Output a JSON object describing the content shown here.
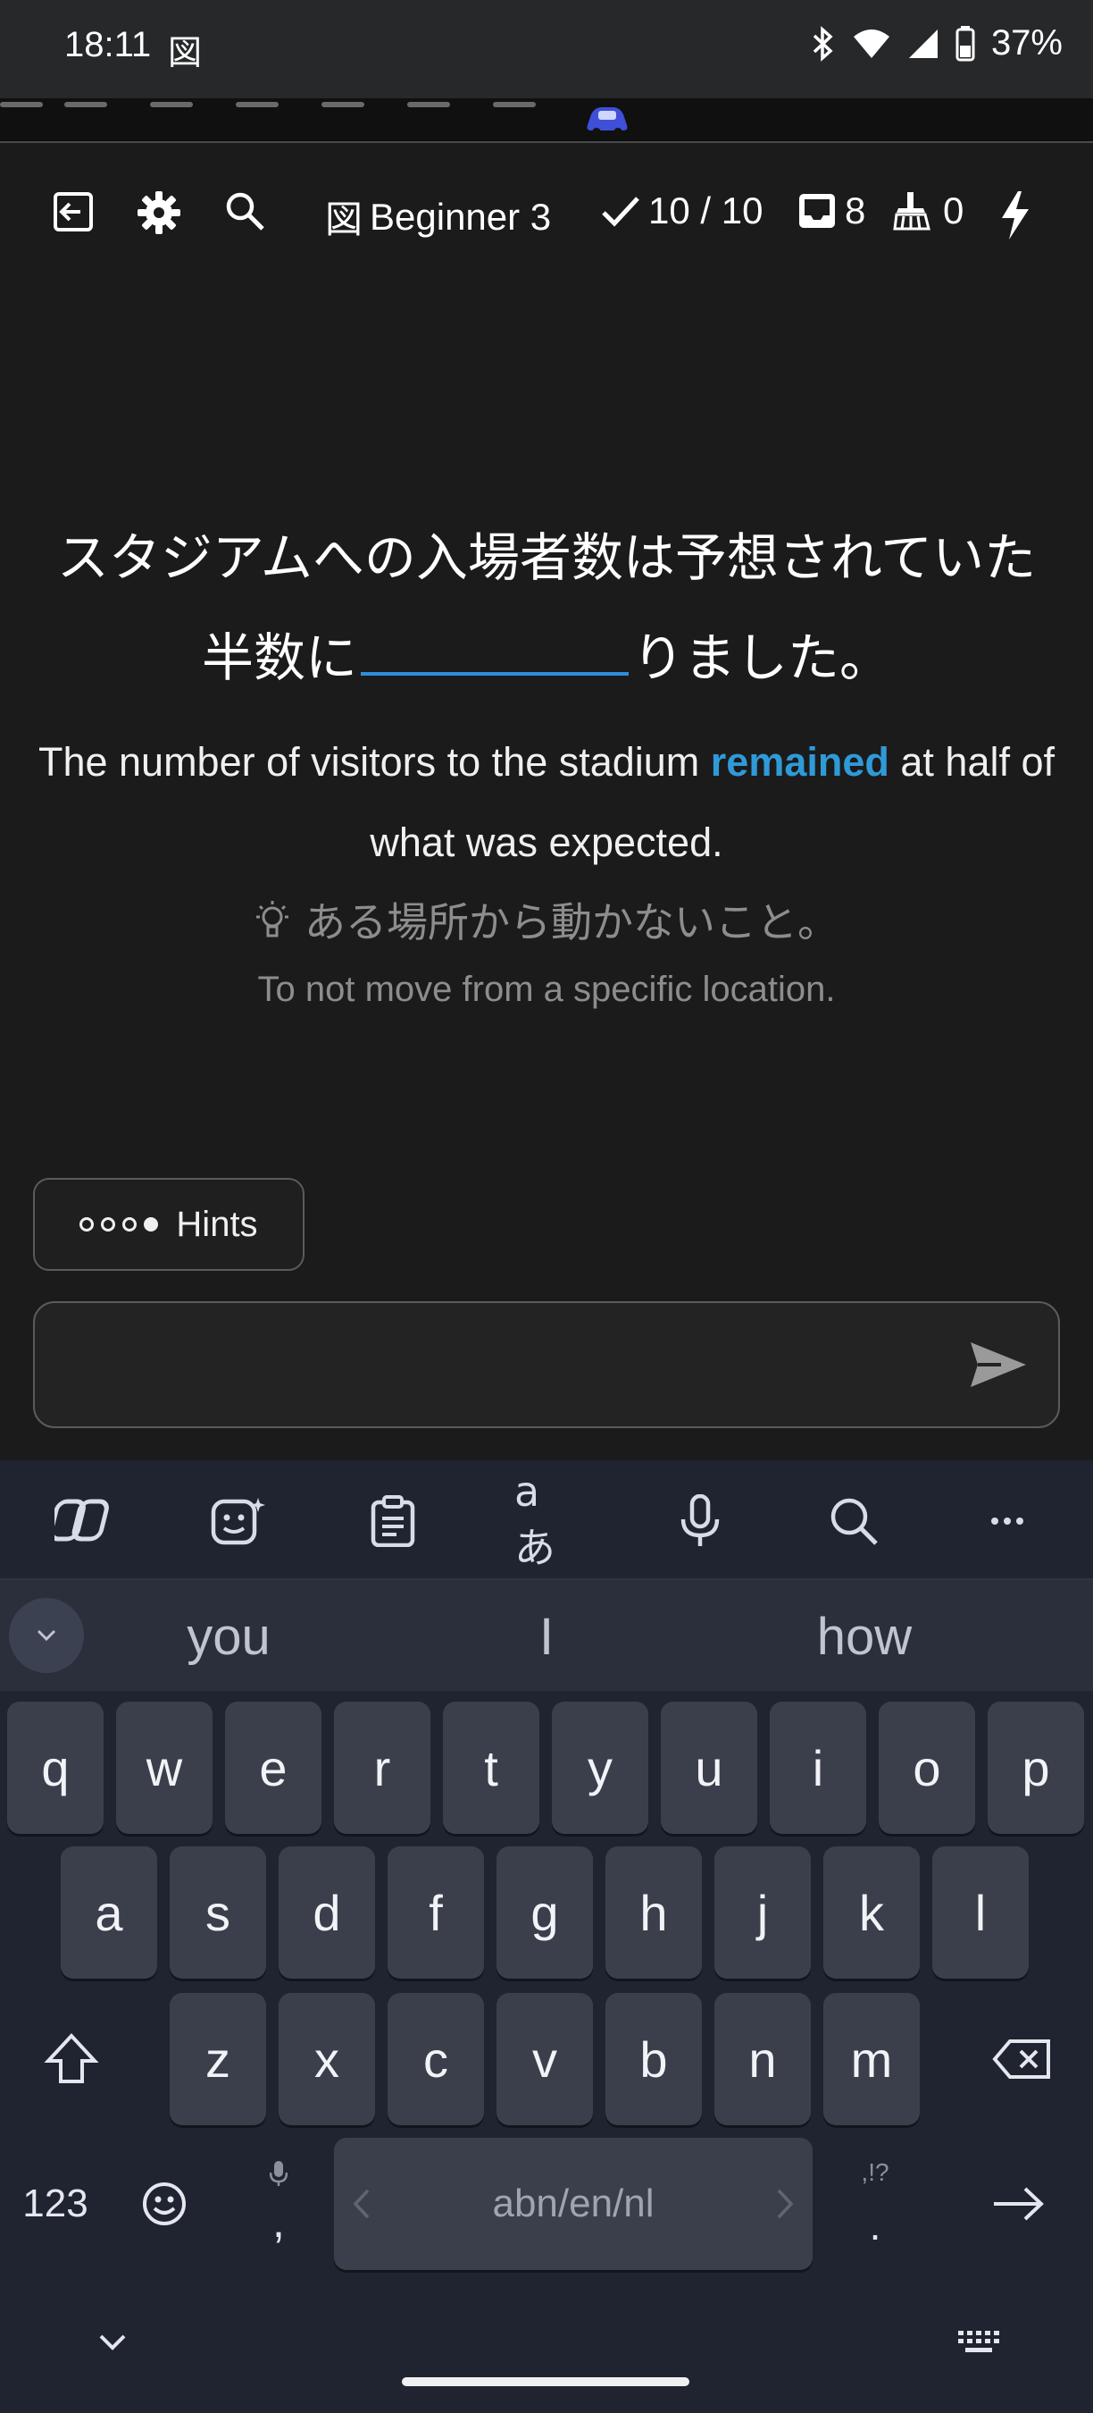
{
  "status_bar": {
    "time": "18:11",
    "app_glyph": "図",
    "battery_percent": "37%",
    "icons": [
      "bluetooth-icon",
      "wifi-icon",
      "signal-icon",
      "battery-icon"
    ]
  },
  "progress": {
    "icon": "car-icon"
  },
  "toolbar": {
    "level_glyph": "図",
    "level": "Beginner 3",
    "correct_count": "10 / 10",
    "inbox_count": "8",
    "sweep_count": "0",
    "icons": [
      "exit-icon",
      "settings-gear-icon",
      "search-icon",
      "check-icon",
      "inbox-icon",
      "broom-icon",
      "lightning-icon"
    ]
  },
  "exercise": {
    "jp_line1": "スタジアムへの入場者数は予想されていた",
    "jp_line2_before": "半数に",
    "jp_line2_after": "りました。",
    "en_before": "The number of visitors to the stadium ",
    "en_highlight": "remained",
    "en_after": " at half of what was expected.",
    "hint_jp": "ある場所から動かないこと。",
    "hint_en": "To not move from a specific location."
  },
  "hints_button": {
    "label": "Hints",
    "dots_total": 4,
    "dots_filled": 1
  },
  "answer": {
    "value": "",
    "placeholder": ""
  },
  "keyboard": {
    "toolbar_icons": [
      "copilot-icon",
      "sticker-icon",
      "clipboard-icon",
      "translate-icon",
      "microphone-icon",
      "search-icon",
      "more-icon"
    ],
    "translate_label": "aあ",
    "suggestions": [
      "you",
      "I",
      "how"
    ],
    "row1": [
      "q",
      "w",
      "e",
      "r",
      "t",
      "y",
      "u",
      "i",
      "o",
      "p"
    ],
    "row2": [
      "a",
      "s",
      "d",
      "f",
      "g",
      "h",
      "j",
      "k",
      "l"
    ],
    "row3": [
      "z",
      "x",
      "c",
      "v",
      "b",
      "n",
      "m"
    ],
    "numbers_label": "123",
    "comma": ",",
    "period": ".",
    "punct_hint": ",!?",
    "space_label": "abn/en/nl",
    "hide_label": "⌄"
  },
  "colors": {
    "accent": "#2f9ad8",
    "background": "#1b1b1b",
    "keyboard": "#1f2430",
    "key": "#3a3f4b"
  }
}
